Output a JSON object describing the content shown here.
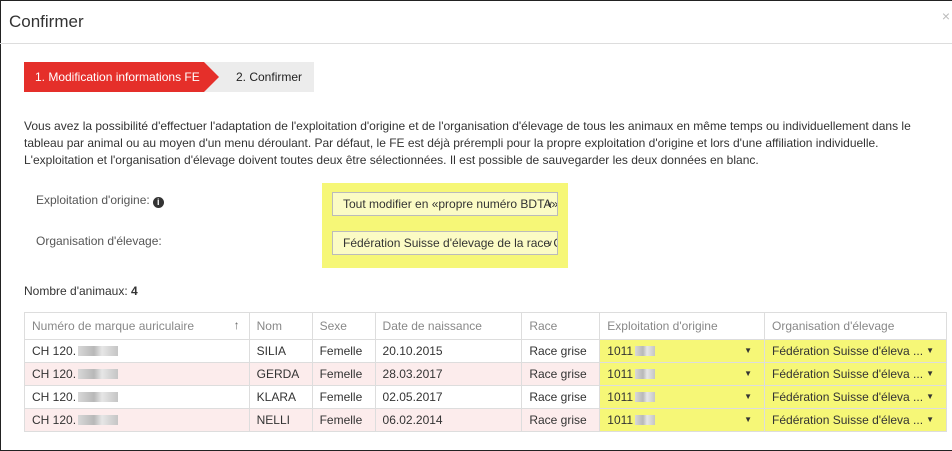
{
  "dialog": {
    "title": "Confirmer",
    "close_label": "×"
  },
  "steps": [
    {
      "label": "1. Modification informations FE"
    },
    {
      "label": "2. Confirmer"
    }
  ],
  "description": "Vous avez la possibilité d'effectuer l'adaptation de l'exploitation d'origine et de l'organisation d'élevage de tous les animaux en même temps ou individuellement dans le tableau par animal ou au moyen d'un menu déroulant. Par défaut, le FE est déjà prérempli pour la propre exploitation d'origine et lors d'une affiliation individuelle. L'exploitation et l'organisation d'élevage doivent toutes deux être sélectionnées. Il est possible de sauvegarder les deux données en blanc.",
  "form": {
    "origin_label": "Exploitation d'origine:",
    "origin_value": "Tout modifier en «propre numéro BDTA»",
    "org_label": "Organisation d'élevage:",
    "org_value": "Fédération Suisse d'élevage de la race Grise"
  },
  "count": {
    "label": "Nombre d'animaux:",
    "value": "4"
  },
  "table": {
    "headers": [
      "Numéro de marque auriculaire",
      "Nom",
      "Sexe",
      "Date de naissance",
      "Race",
      "Exploitation d'origine",
      "Organisation d'élevage"
    ],
    "rows": [
      {
        "ear": "CH 120.",
        "name": "SILIA",
        "sex": "Femelle",
        "birth": "20.10.2015",
        "race": "Race grise",
        "origin": "1011",
        "org": "Fédération Suisse d'éleva ..."
      },
      {
        "ear": "CH 120.",
        "name": "GERDA",
        "sex": "Femelle",
        "birth": "28.03.2017",
        "race": "Race grise",
        "origin": "1011",
        "org": "Fédération Suisse d'éleva ..."
      },
      {
        "ear": "CH 120.",
        "name": "KLARA",
        "sex": "Femelle",
        "birth": "02.05.2017",
        "race": "Race grise",
        "origin": "1011",
        "org": "Fédération Suisse d'éleva ..."
      },
      {
        "ear": "CH 120.",
        "name": "NELLI",
        "sex": "Femelle",
        "birth": "06.02.2014",
        "race": "Race grise",
        "origin": "1011",
        "org": "Fédération Suisse d'éleva ..."
      }
    ]
  },
  "colors": {
    "accent": "#e52f2a",
    "highlight": "#f6f777",
    "row_alt": "#fcecec"
  }
}
